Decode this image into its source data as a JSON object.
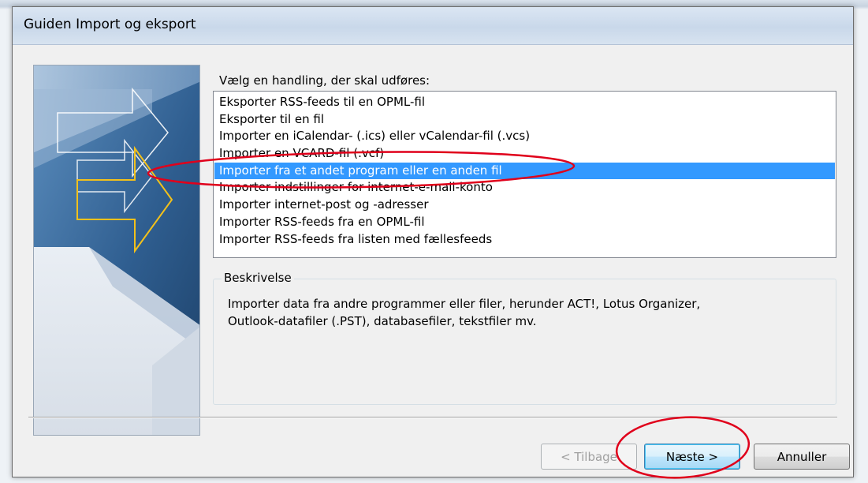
{
  "window": {
    "title": "Guiden Import og eksport"
  },
  "prompt": "Vælg en handling, der skal udføres:",
  "actions": [
    "Eksporter RSS-feeds til en OPML-fil",
    "Eksporter til en fil",
    "Importer en iCalendar- (.ics) eller vCalendar-fil (.vcs)",
    "Importer en VCARD-fil (.vcf)",
    "Importer fra et andet program eller en anden fil",
    "Importer indstillinger for internet-e-mail-konto",
    "Importer internet-post og -adresser",
    "Importer RSS-feeds fra en OPML-fil",
    "Importer RSS-feeds fra listen med fællesfeeds"
  ],
  "selected_action": "Importer fra et andet program eller en anden fil",
  "description": {
    "legend": "Beskrivelse",
    "line1": "Importer data fra andre programmer eller filer, herunder ACT!, Lotus Organizer,",
    "line2": "Outlook-datafiler (.PST), databasefiler, tekstfiler mv."
  },
  "buttons": {
    "back": "< Tilbage",
    "next": "Næste >",
    "cancel": "Annuller"
  },
  "colors": {
    "selection": "#3399ff",
    "annotation": "#e0001b",
    "banner_blue": "#2e5c8e",
    "banner_arrow": "#f3c11b"
  }
}
